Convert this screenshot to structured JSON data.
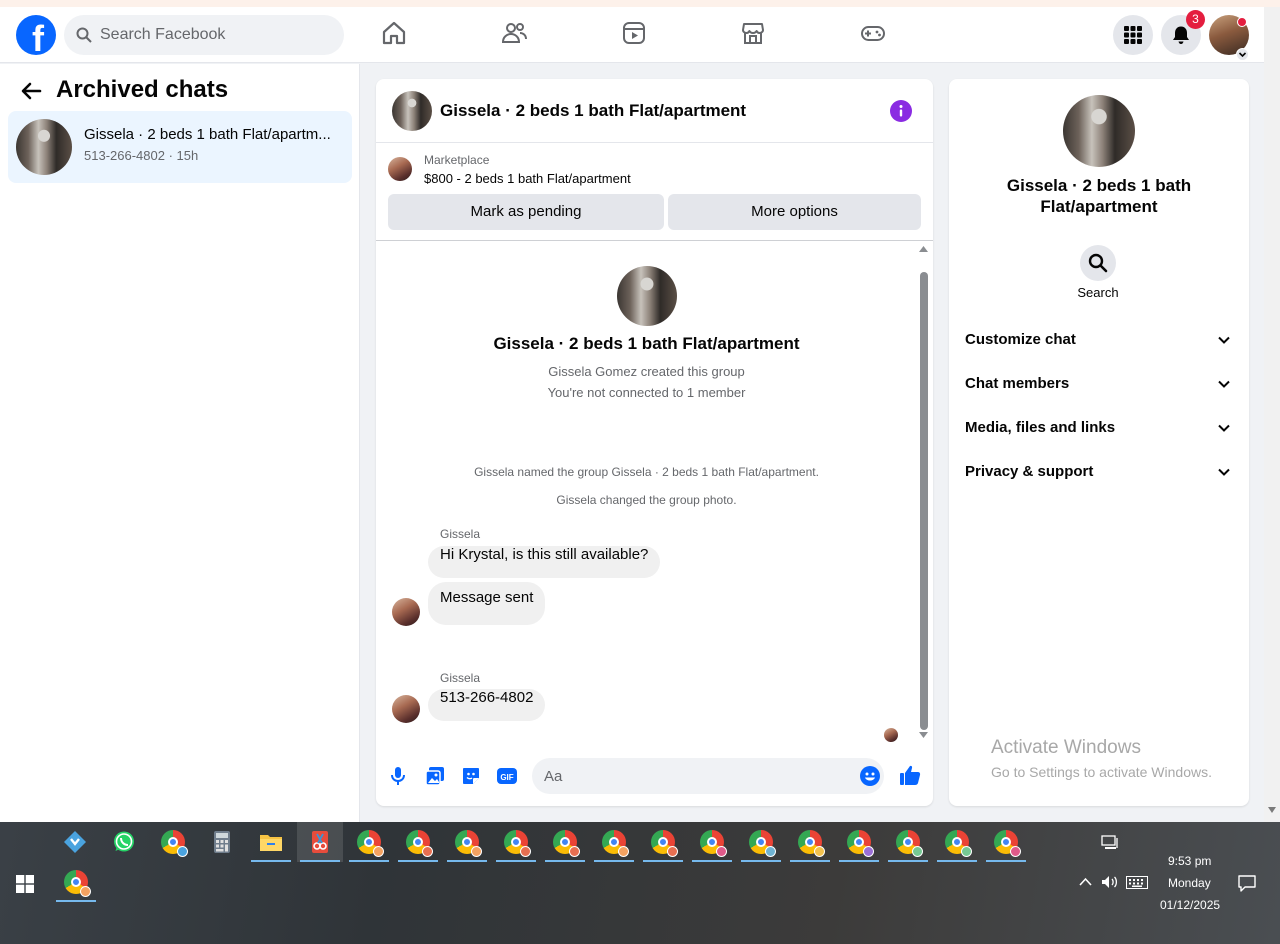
{
  "header": {
    "search_placeholder": "Search Facebook",
    "notification_count": "3"
  },
  "sidebar": {
    "title": "Archived chats",
    "chat": {
      "name": "Gissela · 2 beds 1 bath Flat/apartm...",
      "phone": "513-266-4802",
      "time": "15h"
    }
  },
  "chat": {
    "title": "Gissela · 2 beds 1 bath Flat/apartment",
    "marketplace_label": "Marketplace",
    "marketplace_item": "$800 - 2 beds 1 bath Flat/apartment",
    "mark_pending_label": "Mark as pending",
    "more_options_label": "More options",
    "group_title": "Gissela · 2 beds 1 bath Flat/apartment",
    "created_text": "Gissela Gomez created this group",
    "not_connected_text": "You're not connected to 1 member",
    "named_event": "Gissela named the group Gissela · 2 beds 1 bath Flat/apartment.",
    "photo_event": "Gissela changed the group photo.",
    "messages": [
      {
        "sender": "Gissela",
        "bubbles": [
          "Hi Krystal, is this still available?",
          "Message sent"
        ]
      },
      {
        "sender": "Gissela",
        "bubbles": [
          "513-266-4802"
        ]
      }
    ],
    "composer_placeholder": "Aa"
  },
  "info_panel": {
    "title": "Gissela · 2 beds 1 bath Flat/apartment",
    "search_label": "Search",
    "sections": [
      "Customize chat",
      "Chat members",
      "Media, files and links",
      "Privacy & support"
    ]
  },
  "watermark": {
    "line1": "Activate Windows",
    "line2": "Go to Settings to activate Windows."
  },
  "taskbar": {
    "time": "9:53 pm",
    "day": "Monday",
    "date": "01/12/2025",
    "chrome_profile_colors": [
      "#f4a261",
      "#e76f51",
      "#f4a261",
      "#e76f51",
      "#e76f51",
      "#f4a261",
      "#e76f51",
      "#e05a8a",
      "#6fb3d2",
      "#f2c14e",
      "#9b6fd6",
      "#76c893",
      "#76c893",
      "#e05a8a"
    ]
  },
  "colors": {
    "brand": "#0866ff",
    "selected_chat_bg": "#ebf5ff",
    "info_purple": "#8a2be2",
    "badge_red": "#e41e3f",
    "composer_blue": "#0866ff"
  }
}
